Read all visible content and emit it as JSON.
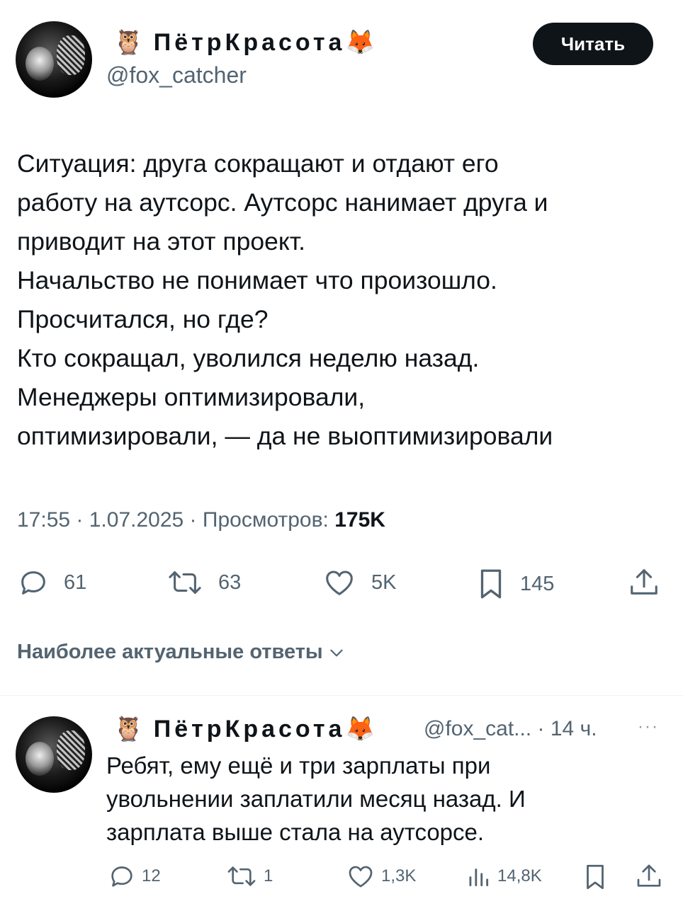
{
  "tweet": {
    "author": {
      "display_name": "ПётрКрасота",
      "owl_emoji": "🦉",
      "fox_emoji": "🦊",
      "handle": "@fox_catcher"
    },
    "follow_label": "Читать",
    "text_lines": [
      "Ситуация: друга сокращают и отдают его",
      "работу на аутсорс. Аутсорс нанимает друга и",
      "приводит на этот проект.",
      "Начальство не понимает что произошло.",
      "Просчитался, но где?",
      "Кто сокращал, уволился неделю назад.",
      "Менеджеры оптимизировали,",
      "оптимизировали, — да не выоптимизировали"
    ],
    "meta": {
      "time": "17:55",
      "date": "1.07.2025",
      "views_label": "Просмотров:",
      "views_count": "175K",
      "separator": " · "
    },
    "actions": {
      "replies": "61",
      "reposts": "63",
      "likes": "5K",
      "bookmarks": "145"
    }
  },
  "replies_sort_label": "Наиболее актуальные ответы",
  "reply": {
    "author": {
      "display_name": "ПётрКрасота",
      "owl_emoji": "🦉",
      "fox_emoji": "🦊",
      "handle": "@fox_cat...",
      "time": "14 ч."
    },
    "handle_time_separator": " · ",
    "more_label": "···",
    "text_lines": [
      "Ребят, ему ещё и три зарплаты при",
      "увольнении заплатили месяц назад. И",
      "зарплата выше стала на аутсорсе."
    ],
    "actions": {
      "replies": "12",
      "reposts": "1",
      "likes": "1,3K",
      "views": "14,8K"
    }
  },
  "colors": {
    "text": "#0f1419",
    "secondary": "#536471",
    "button_bg": "#0f1419",
    "divider": "#eff3f4"
  }
}
